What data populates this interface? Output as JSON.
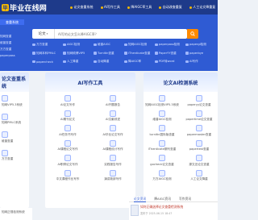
{
  "header": {
    "logo_mark": "毕",
    "logo_text": "毕业在线网",
    "nav": [
      {
        "label": "论文查重系统"
      },
      {
        "label": "AI写作工具"
      },
      {
        "label": "降AIGC率工具"
      },
      {
        "label": "自动改查重复"
      },
      {
        "label": "人工论文降重复"
      }
    ]
  },
  "sidebar": {
    "button": "查重系统",
    "links": [
      "知网查重",
      "维普查重",
      "万方查重",
      "paperpass"
    ]
  },
  "search": {
    "category": "论文",
    "placeholder": "AI写的论文怎么降AIGC率？"
  },
  "quick_links": [
    "万方查重",
    "AIGC检测",
    "维普AIGC",
    "知网AIGC检测",
    "paperpass检测",
    "papergi检测",
    "知网本科PMLC",
    "知网硕博VIP5",
    "TurnitIn查重",
    "iThenticate查重",
    "PaperYY查重",
    "paperbye",
    "papercheck",
    "人工降重",
    "自动降重",
    "降AIGC率",
    "PDF转word",
    "AI写作"
  ],
  "panels": {
    "left": {
      "title": "论文查重系统",
      "items": [
        "知网VIP5.3系统",
        "知网PMLC系统",
        "维普查重",
        "万方查重"
      ]
    },
    "middle": {
      "title": "AI写作工具",
      "items": [
        "AI论文写作",
        "AI开题报告",
        "AI期刊论文",
        "AI文献综述",
        "AI任务书写作",
        "AI毕业论文写作",
        "AI课程论文写作",
        "AI课程设计写作",
        "AI职称论文写作",
        "实践报告写作",
        "中文课程作业写作",
        "演讲致辞写作"
      ]
    },
    "right": {
      "title": "论文AI检测系统",
      "items": [
        "知网AIGC检测VIP5.3系统",
        "paperyy论文查重",
        "维普AIGC检测",
        "papertime论文查重",
        "turnitin国际版查重",
        "papermaster查重",
        "iThenticate期刊查重",
        "papertest查重",
        "gocheck论文查重",
        "源文迅论文查重",
        "万方AIGC检测",
        "人工论文降重"
      ]
    }
  },
  "news": {
    "tabs": [
      {
        "label": "论文资讯",
        "active": true
      },
      {
        "label": "降AIGC资讯",
        "active": false
      },
      {
        "label": "写作资讯",
        "active": false
      }
    ],
    "item_title": "如何正确选择论文查重检测系统",
    "item_date": "发布于 2025-06-15 18:47"
  },
  "left_bottom": "知网正规检测系统",
  "colors": {
    "brand_dark": "#1e3a8a",
    "brand": "#2f5bd3",
    "accent_orange": "#ff8a00",
    "accent_yellow": "#f5b800"
  }
}
